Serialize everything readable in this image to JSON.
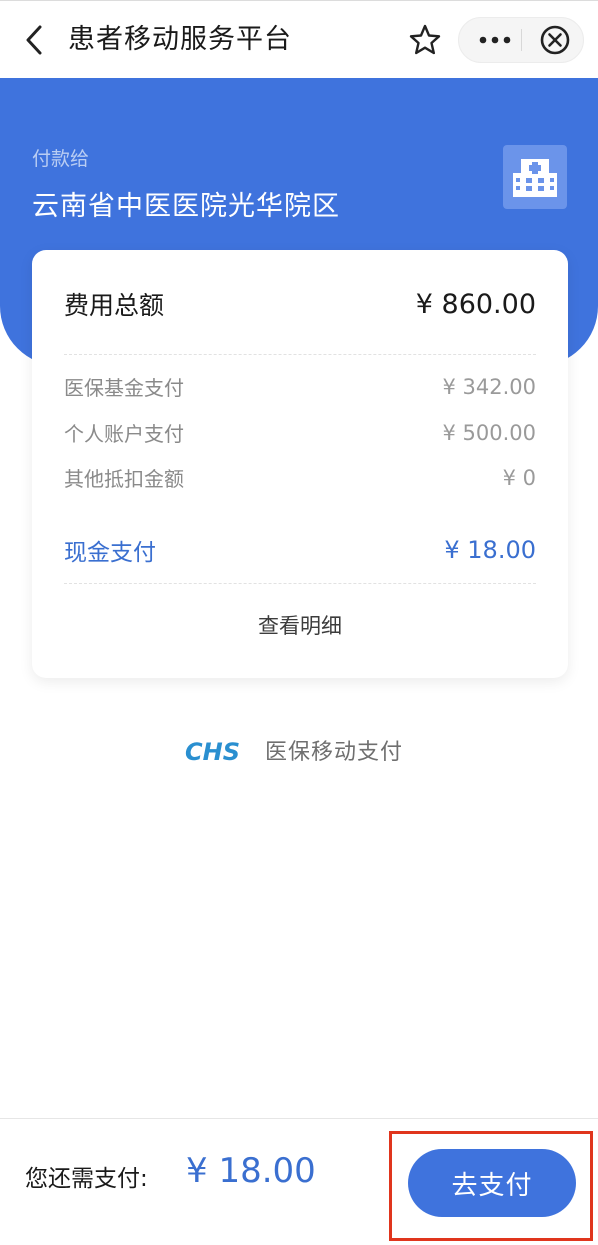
{
  "header": {
    "title": "患者移动服务平台",
    "icons": [
      "back-icon",
      "star-icon",
      "more-icon",
      "close-icon"
    ]
  },
  "payee": {
    "label": "付款给",
    "name": "云南省中医医院光华院区",
    "icon": "hospital-icon"
  },
  "summary": {
    "total_label": "费用总额",
    "total_value": "¥ 860.00",
    "items": [
      {
        "label": "医保基金支付",
        "value": "¥ 342.00"
      },
      {
        "label": "个人账户支付",
        "value": "¥ 500.00"
      },
      {
        "label": "其他抵扣金额",
        "value": "¥ 0"
      }
    ],
    "cash_label": "现金支付",
    "cash_value": "¥ 18.00",
    "detail_link": "查看明细"
  },
  "brand": {
    "logo": "CHS",
    "text": "医保移动支付"
  },
  "footer": {
    "due_label": "您还需支付:",
    "due_value": "¥ 18.00",
    "pay_button": "去支付"
  },
  "colors": {
    "primary": "#3f73dd",
    "accent_text": "#3a6fd0",
    "highlight": "#e0351d",
    "brand": "#2a8fd0"
  }
}
